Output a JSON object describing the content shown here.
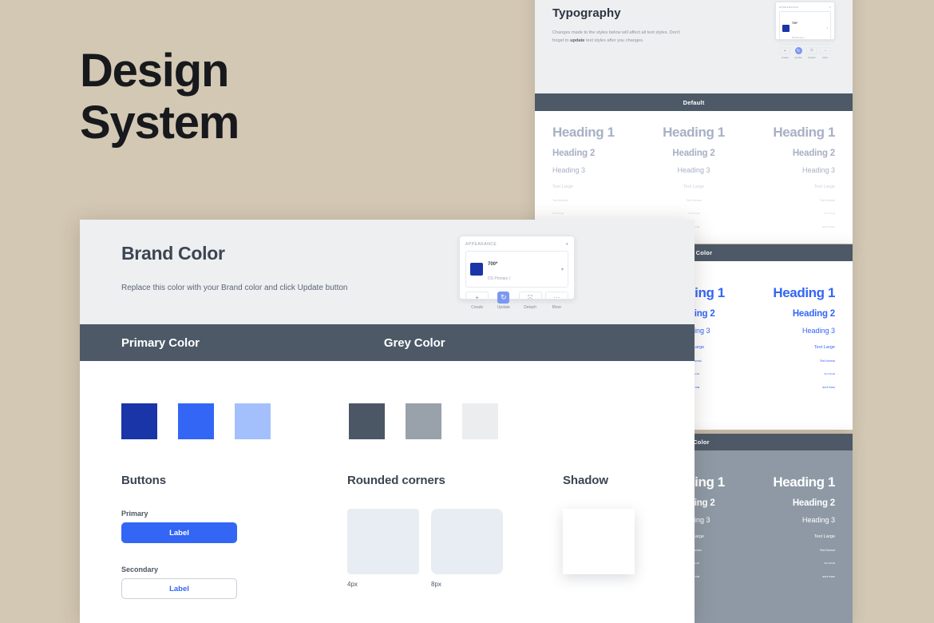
{
  "page": {
    "title": "Design\nSystem",
    "background_color": "#d3c8b4"
  },
  "typography_panel": {
    "heading": "Typography",
    "description": "Changes made to the styles below will affect all text styles. Don't forget to update text styles after you changes.",
    "description_part1": "Changes made to the styles below will affect all text styles. Don't forget to ",
    "description_bold": "update",
    "description_part2": " text styles after you changes.",
    "bar_label": "Default",
    "appearance": {
      "title": "APPEARANCE",
      "style_name": "700*",
      "style_sub": "DS Primary /",
      "swatch_color": "#1a35a8",
      "buttons": [
        {
          "label": "Create",
          "glyph": "+"
        },
        {
          "label": "Update",
          "glyph": "↻"
        },
        {
          "label": "Detach",
          "glyph": "⤧"
        },
        {
          "label": "More",
          "glyph": "···"
        }
      ]
    },
    "scale": {
      "h1": "Heading 1",
      "h2": "Heading 2",
      "h3": "Heading 3",
      "text_large": "Text Large",
      "text_normal": "Text Normal",
      "text_small": "Text Small",
      "button": "BUTTON"
    }
  },
  "primary_type_panel": {
    "bar_label": "Primary Color",
    "accent_color": "#3366f5"
  },
  "grey_type_panel": {
    "bar_label": "Grey Color",
    "background_color": "#8e99a5"
  },
  "brand_panel": {
    "heading": "Brand Color",
    "description": "Replace this color with your Brand color and click Update button",
    "appearance": {
      "title": "APPEARANCE",
      "style_name": "700*",
      "style_sub": "DS Primary /",
      "swatch_color": "#1a35a8",
      "buttons": [
        {
          "label": "Create",
          "glyph": "+"
        },
        {
          "label": "Update",
          "glyph": "↻"
        },
        {
          "label": "Detach",
          "glyph": "⤧"
        },
        {
          "label": "More",
          "glyph": "···"
        }
      ]
    },
    "color_bar": {
      "primary_label": "Primary Color",
      "grey_label": "Grey Color"
    },
    "primary_swatches": [
      "#1a35a8",
      "#3366f5",
      "#a4c0fc"
    ],
    "grey_swatches": [
      "#4b5765",
      "#99a1ab",
      "#ebedef"
    ],
    "buttons_section": {
      "title": "Buttons",
      "primary_label": "Primary",
      "primary_button": "Label",
      "secondary_label": "Secondary",
      "secondary_button": "Label"
    },
    "rounded_section": {
      "title": "Rounded corners",
      "items": [
        {
          "caption": "4px"
        },
        {
          "caption": "8px"
        }
      ]
    },
    "shadow_section": {
      "title": "Shadow"
    }
  }
}
